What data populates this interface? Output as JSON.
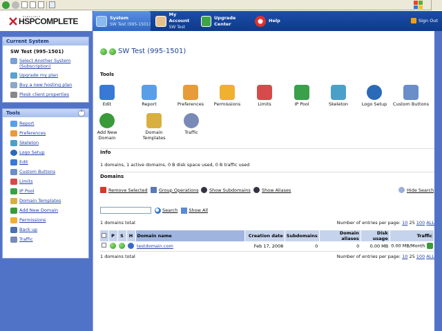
{
  "header": {
    "logo_small": "PARALLELS",
    "logo_main": "HSPCOMPLETE",
    "tabs": [
      {
        "title": "System",
        "subtitle": "SW Test (995-1501)"
      },
      {
        "title": "My Account",
        "subtitle": "SW Test"
      },
      {
        "title": "Upgrade Center",
        "subtitle": ""
      },
      {
        "title": "Help",
        "subtitle": ""
      }
    ],
    "sign_out": "Sign Out"
  },
  "sidebar": {
    "current_system": {
      "title": "Current System",
      "name": "SW Test (995-1501)",
      "items": [
        {
          "label": "Select Another System",
          "label2": "(Subscription)",
          "icon": "list-icon"
        },
        {
          "label": "Upgrade my plan",
          "icon": "upgrade-icon"
        },
        {
          "label": "Buy a new hosting plan",
          "icon": "cart-icon"
        },
        {
          "label": "Plesk client properties",
          "icon": "properties-icon"
        }
      ]
    },
    "tools": {
      "title": "Tools",
      "collapse": "^",
      "items": [
        {
          "label": "Report",
          "icon": "report-icon"
        },
        {
          "label": "Preferences",
          "icon": "preferences-icon"
        },
        {
          "label": "Skeleton",
          "icon": "skeleton-icon"
        },
        {
          "label": "Logo Setup",
          "icon": "logo-setup-icon"
        },
        {
          "label": "Edit",
          "icon": "edit-icon"
        },
        {
          "label": "Custom Buttons",
          "icon": "custom-buttons-icon"
        },
        {
          "label": "Limits",
          "icon": "limits-icon"
        },
        {
          "label": "IP Pool",
          "icon": "ip-pool-icon"
        },
        {
          "label": "Domain Templates",
          "icon": "domain-templates-icon"
        },
        {
          "label": "Add New Domain",
          "icon": "add-domain-icon"
        },
        {
          "label": "Permissions",
          "icon": "permissions-icon"
        },
        {
          "label": "Back up",
          "icon": "backup-icon"
        },
        {
          "label": "Traffic",
          "icon": "traffic-icon"
        }
      ]
    }
  },
  "main": {
    "title": "SW Test (995-1501)",
    "tools_heading": "Tools",
    "tools_row1": [
      {
        "label": "Edit",
        "label2": "",
        "icon": "edit-icon",
        "color": "#3a78d6"
      },
      {
        "label": "Report",
        "label2": "",
        "icon": "report-icon",
        "color": "#5a9ee8"
      },
      {
        "label": "Preferences",
        "label2": "",
        "icon": "preferences-icon",
        "color": "#e89b3a"
      },
      {
        "label": "Permissions",
        "label2": "",
        "icon": "permissions-icon",
        "color": "#f0b030"
      },
      {
        "label": "Limits",
        "label2": "",
        "icon": "limits-icon",
        "color": "#d64a4a"
      },
      {
        "label": "IP Pool",
        "label2": "",
        "icon": "ip-pool-icon",
        "color": "#3aa04a"
      },
      {
        "label": "Skeleton",
        "label2": "",
        "icon": "skeleton-icon",
        "color": "#4aa0c8"
      },
      {
        "label": "Logo Setup",
        "label2": "",
        "icon": "logo-setup-icon",
        "color": "#2a6ab8"
      },
      {
        "label": "Custom Buttons",
        "label2": "",
        "icon": "custom-buttons-icon",
        "color": "#6a8ec8"
      }
    ],
    "tools_row2": [
      {
        "label": "Add New Domain",
        "label2": "",
        "icon": "add-domain-icon",
        "color": "#3a9a3a"
      },
      {
        "label": "Domain",
        "label2": "Templates",
        "icon": "domain-templates-icon",
        "color": "#d8b040"
      },
      {
        "label": "Traffic",
        "label2": "",
        "icon": "traffic-icon",
        "color": "#7a8ab8"
      }
    ],
    "info_heading": "Info",
    "info_text": "1 domains, 1 active domains, 0 B disk space used, 0 B traffic used",
    "domains_heading": "Domains",
    "actions": {
      "remove": "Remove Selected",
      "group": "Group Operations",
      "show_subdomains": "Show Subdomains",
      "show_aliases": "Show Aliases",
      "hide_search": "Hide Search"
    },
    "search": {
      "value": "",
      "search_label": "Search",
      "show_all_label": "Show All"
    },
    "count_text": "1 domains total",
    "per_page_label": "Number of entries per page:",
    "per_page": [
      "10",
      "25",
      "100",
      "ALL"
    ],
    "table": {
      "headers": [
        "P",
        "S",
        "H",
        "Domain name",
        "Creation date",
        "Subdomains",
        "Domain aliases",
        "Disk usage",
        "Traffic"
      ],
      "rows": [
        {
          "domain": "testdomain.com",
          "created": "Feb 17, 2008",
          "subdomains": "0",
          "aliases": "0",
          "disk": "0.00 MB",
          "traffic": "0.00 MB/Month"
        }
      ]
    }
  },
  "colors": {
    "nav_bg": "#1c4ea8",
    "sidebar_bg": "#5173c7",
    "link": "#1e3fa8",
    "table_header": "#c6d3ec"
  }
}
